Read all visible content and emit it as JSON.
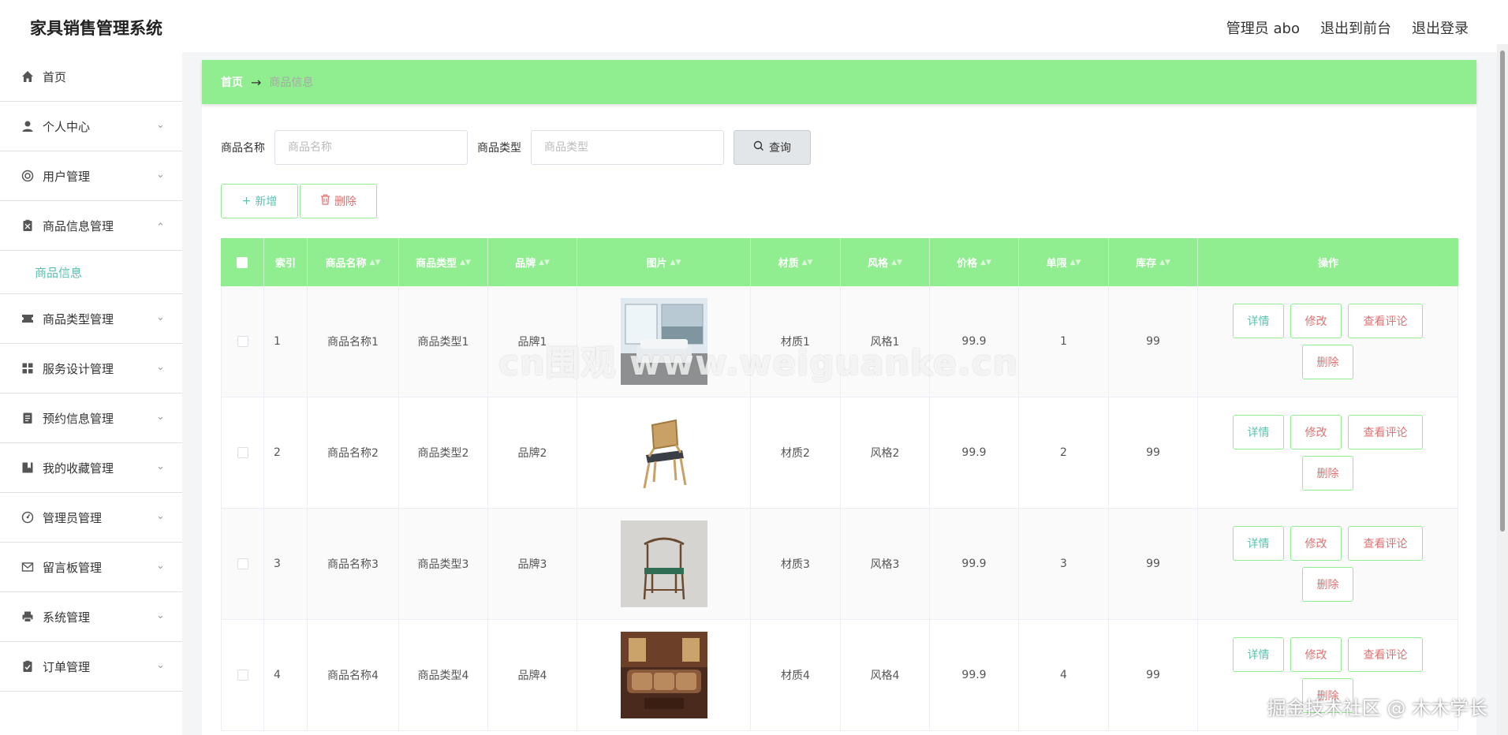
{
  "app": {
    "title": "家具销售管理系统"
  },
  "header": {
    "admin": "管理员 abo",
    "to_front": "退出到前台",
    "logout": "退出登录"
  },
  "sidebar": {
    "items": [
      {
        "label": "首页",
        "icon": "home-icon"
      },
      {
        "label": "个人中心",
        "icon": "user-icon"
      },
      {
        "label": "用户管理",
        "icon": "users-icon"
      },
      {
        "label": "商品信息管理",
        "icon": "clipboard-icon",
        "expanded": true,
        "sub": "商品信息"
      },
      {
        "label": "商品类型管理",
        "icon": "ticket-icon"
      },
      {
        "label": "服务设计管理",
        "icon": "grid-icon"
      },
      {
        "label": "预约信息管理",
        "icon": "document-icon"
      },
      {
        "label": "我的收藏管理",
        "icon": "bookmark-icon"
      },
      {
        "label": "管理员管理",
        "icon": "gauge-icon"
      },
      {
        "label": "留言板管理",
        "icon": "mail-icon"
      },
      {
        "label": "系统管理",
        "icon": "printer-icon"
      },
      {
        "label": "订单管理",
        "icon": "checklist-icon"
      }
    ]
  },
  "breadcrumb": {
    "home": "首页",
    "arrow": "→",
    "current": "商品信息"
  },
  "search": {
    "name_label": "商品名称",
    "name_placeholder": "商品名称",
    "type_label": "商品类型",
    "type_placeholder": "商品类型",
    "query_button": "查询"
  },
  "actions": {
    "add": "新增",
    "delete": "删除"
  },
  "table": {
    "columns": [
      "索引",
      "商品名称",
      "商品类型",
      "品牌",
      "图片",
      "材质",
      "风格",
      "价格",
      "单限",
      "库存",
      "操作"
    ],
    "rows": [
      {
        "index": "1",
        "name": "商品名称1",
        "type": "商品类型1",
        "brand": "品牌1",
        "material": "材质1",
        "style": "风格1",
        "price": "99.9",
        "limit": "1",
        "stock": "99"
      },
      {
        "index": "2",
        "name": "商品名称2",
        "type": "商品类型2",
        "brand": "品牌2",
        "material": "材质2",
        "style": "风格2",
        "price": "99.9",
        "limit": "2",
        "stock": "99"
      },
      {
        "index": "3",
        "name": "商品名称3",
        "type": "商品类型3",
        "brand": "品牌3",
        "material": "材质3",
        "style": "风格3",
        "price": "99.9",
        "limit": "3",
        "stock": "99"
      },
      {
        "index": "4",
        "name": "商品名称4",
        "type": "商品类型4",
        "brand": "品牌4",
        "material": "材质4",
        "style": "风格4",
        "price": "99.9",
        "limit": "4",
        "stock": "99"
      }
    ],
    "row_actions": {
      "detail": "详情",
      "edit": "修改",
      "review": "查看评论",
      "delete": "删除"
    }
  },
  "watermarks": {
    "center": "cn围观 www.weiguanke.cn",
    "corner": "掘金技术社区 @ 木木学长"
  },
  "colors": {
    "accent": "#90ee90",
    "link": "#5cc0b0",
    "danger": "#e07070"
  }
}
